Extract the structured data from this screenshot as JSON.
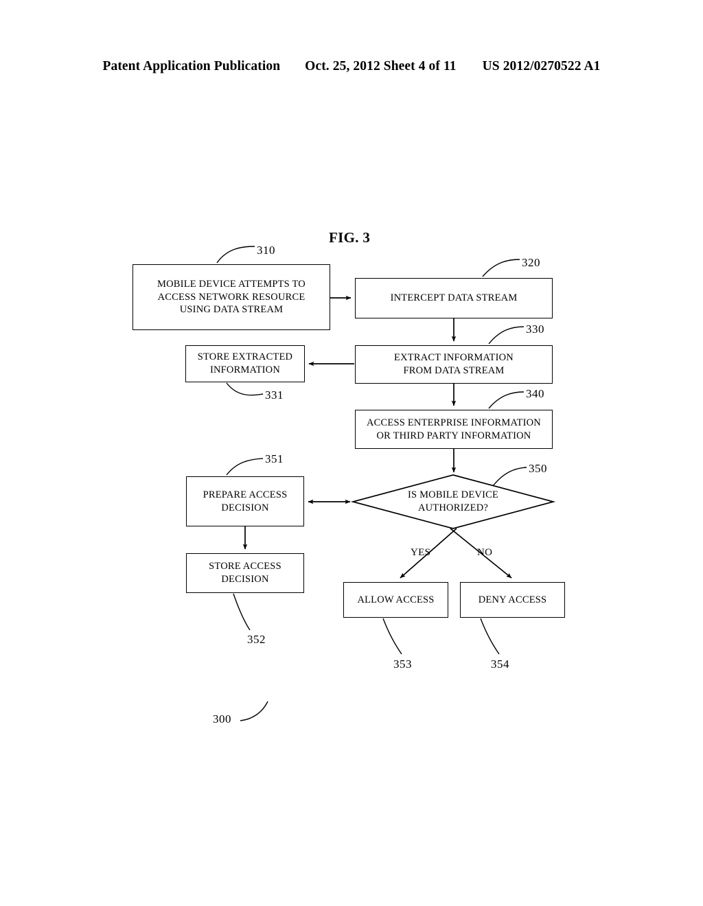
{
  "header": {
    "left": "Patent Application Publication",
    "middle": "Oct. 25, 2012  Sheet 4 of 11",
    "right": "US 2012/0270522 A1"
  },
  "figure": {
    "title": "FIG. 3",
    "overall_ref": "300"
  },
  "diagram": {
    "type": "flowchart",
    "nodes": [
      {
        "id": "310",
        "shape": "rect",
        "ref": "310",
        "text": "MOBILE DEVICE ATTEMPTS TO\nACCESS NETWORK RESOURCE\nUSING DATA STREAM"
      },
      {
        "id": "320",
        "shape": "rect",
        "ref": "320",
        "text": "INTERCEPT DATA STREAM"
      },
      {
        "id": "330",
        "shape": "rect",
        "ref": "330",
        "text": "EXTRACT INFORMATION\nFROM DATA STREAM"
      },
      {
        "id": "331",
        "shape": "rect",
        "ref": "331",
        "text": "STORE EXTRACTED\nINFORMATION"
      },
      {
        "id": "340",
        "shape": "rect",
        "ref": "340",
        "text": "ACCESS ENTERPRISE INFORMATION\nOR THIRD PARTY INFORMATION"
      },
      {
        "id": "350",
        "shape": "diamond",
        "ref": "350",
        "text": "IS MOBILE DEVICE\nAUTHORIZED?"
      },
      {
        "id": "351",
        "shape": "rect",
        "ref": "351",
        "text": "PREPARE ACCESS\nDECISION"
      },
      {
        "id": "352",
        "shape": "rect",
        "ref": "352",
        "text": "STORE ACCESS\nDECISION"
      },
      {
        "id": "353",
        "shape": "rect",
        "ref": "353",
        "text": "ALLOW ACCESS"
      },
      {
        "id": "354",
        "shape": "rect",
        "ref": "354",
        "text": "DENY ACCESS"
      }
    ],
    "edges": [
      {
        "from": "310",
        "to": "320",
        "label": ""
      },
      {
        "from": "320",
        "to": "330",
        "label": ""
      },
      {
        "from": "330",
        "to": "331",
        "label": ""
      },
      {
        "from": "330",
        "to": "340",
        "label": ""
      },
      {
        "from": "340",
        "to": "350",
        "label": ""
      },
      {
        "from": "350",
        "to": "351",
        "label": "",
        "arrows": "both"
      },
      {
        "from": "351",
        "to": "352",
        "label": ""
      },
      {
        "from": "350",
        "to": "353",
        "label": "YES"
      },
      {
        "from": "350",
        "to": "354",
        "label": "NO"
      }
    ],
    "branch_labels": {
      "yes": "YES",
      "no": "NO"
    }
  },
  "colors": {
    "ink": "#000000",
    "paper": "#ffffff"
  }
}
